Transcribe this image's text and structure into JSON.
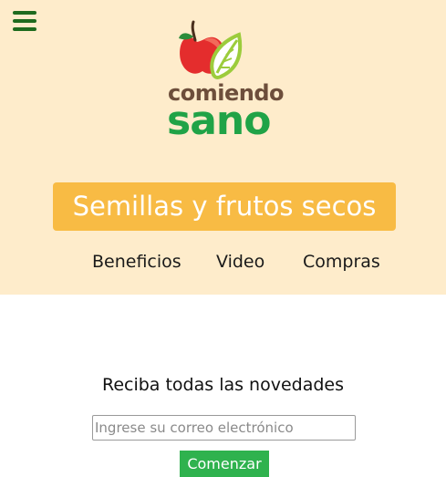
{
  "header": {
    "logo": {
      "line1": "comiendo",
      "line2": "sano"
    },
    "category_label": "Semillas y frutos secos",
    "nav": [
      {
        "label": "Beneficios"
      },
      {
        "label": "Video"
      },
      {
        "label": "Compras"
      }
    ]
  },
  "newsletter": {
    "title": "Reciba todas las novedades",
    "email_placeholder": "Ingrese su correo electrónico",
    "submit_label": "Comenzar"
  },
  "colors": {
    "header_bg": "#feeccb",
    "category_bg": "#f8bb44",
    "button_green": "#2fb24e",
    "menu_green": "#1e6b1e",
    "logo_brown": "#6d4e3b",
    "logo_green": "#20a347"
  },
  "icons": {
    "menu": "hamburger-menu-icon",
    "logo_mark": "apple-leaf-logo-icon"
  }
}
